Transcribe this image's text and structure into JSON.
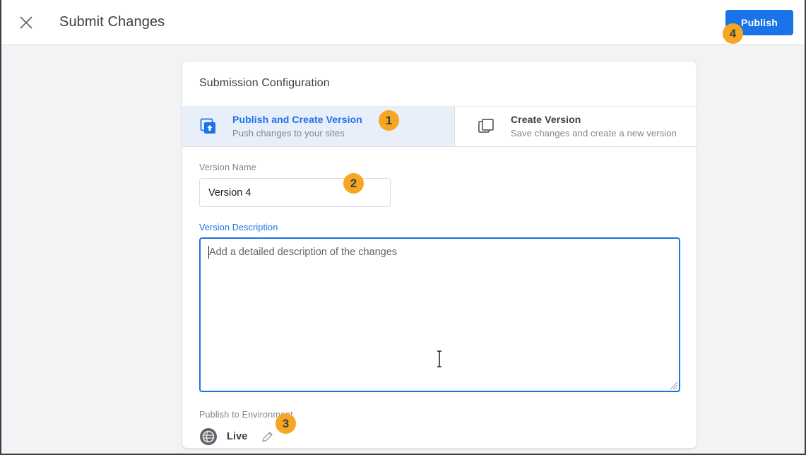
{
  "topbar": {
    "close_icon": "close-icon",
    "title": "Submit Changes",
    "publish_label": "Publish"
  },
  "card": {
    "title": "Submission Configuration"
  },
  "tabs": [
    {
      "id": "publish-and-create-version",
      "icon": "publish-upload-icon",
      "title": "Publish and Create Version",
      "subtitle": "Push changes to your sites",
      "active": true
    },
    {
      "id": "create-version",
      "icon": "copy-version-icon",
      "title": "Create Version",
      "subtitle": "Save changes and create a new version",
      "active": false
    }
  ],
  "form": {
    "version_name": {
      "label": "Version Name",
      "value": "Version 4",
      "placeholder": ""
    },
    "version_description": {
      "label": "Version Description",
      "value": "",
      "placeholder": "Add a detailed description of the changes"
    },
    "environment": {
      "label": "Publish to Environment",
      "icon": "globe-environment-icon",
      "name": "Live",
      "edit_icon": "pencil-edit-icon"
    }
  },
  "annotations": [
    {
      "id": "badge-1",
      "number": "1"
    },
    {
      "id": "badge-2",
      "number": "2"
    },
    {
      "id": "badge-3",
      "number": "3"
    },
    {
      "id": "badge-4",
      "number": "4"
    }
  ],
  "colors": {
    "accent_blue": "#1a73e8",
    "badge_orange": "#f5a623",
    "page_background": "#f1f3f4",
    "active_tab_background": "#e8eefa",
    "muted_text": "#80868b"
  },
  "cursor": {
    "type": "text-ibeam"
  }
}
